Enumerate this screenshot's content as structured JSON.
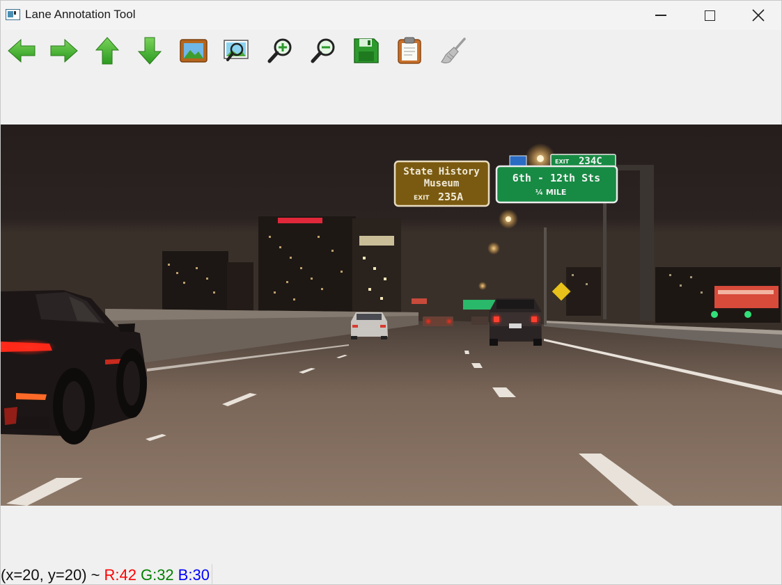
{
  "window": {
    "title": "Lane Annotation Tool"
  },
  "toolbar": {
    "items": [
      {
        "name": "arrow-left",
        "icon": "arrow-left-icon"
      },
      {
        "name": "arrow-right",
        "icon": "arrow-right-icon"
      },
      {
        "name": "arrow-up",
        "icon": "arrow-up-icon"
      },
      {
        "name": "arrow-down",
        "icon": "arrow-down-icon"
      },
      {
        "name": "image",
        "icon": "image-icon"
      },
      {
        "name": "zoom-fit",
        "icon": "zoom-fit-icon"
      },
      {
        "name": "zoom-in",
        "icon": "zoom-in-icon"
      },
      {
        "name": "zoom-out",
        "icon": "zoom-out-icon"
      },
      {
        "name": "save",
        "icon": "save-icon"
      },
      {
        "name": "clipboard",
        "icon": "clipboard-icon"
      },
      {
        "name": "clear",
        "icon": "broom-icon"
      }
    ]
  },
  "scene": {
    "sign_left": {
      "line1": "State History",
      "line2": "Museum",
      "exit_label": "EXIT",
      "exit_num": "235A"
    },
    "sign_right": {
      "tab_exit_label": "EXIT",
      "tab_exit_num": "234C",
      "line1": "6th - 12th Sts",
      "line2": "¼ MILE"
    }
  },
  "status": {
    "coord": "(x=20, y=20) ~",
    "r": "R:42",
    "g": "G:32",
    "b": "B:30"
  },
  "colors": {
    "status_r": "#ff0000",
    "status_g": "#008000",
    "status_b": "#0000ff",
    "arrow_green": "#3cae2c"
  }
}
